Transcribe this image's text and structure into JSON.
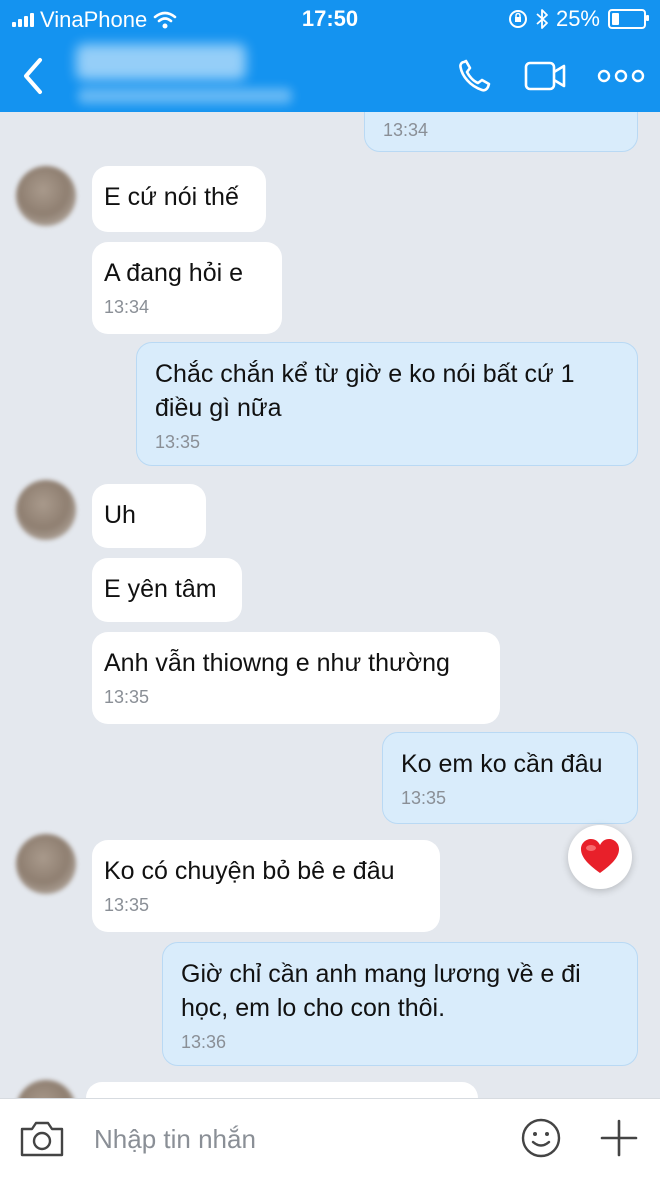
{
  "status_bar": {
    "carrier": "VinaPhone",
    "time": "17:50",
    "battery": "25%",
    "battery_level": 0.25,
    "icons": [
      "signal-icon",
      "wifi-icon",
      "orientation-lock-icon",
      "bluetooth-icon",
      "battery-icon"
    ]
  },
  "header": {
    "icons": [
      "back-icon",
      "phone-icon",
      "video-camera-icon",
      "more-icon"
    ],
    "background": "#1493f0"
  },
  "colors": {
    "outgoing_bubble": "#d9ecfb",
    "incoming_bubble": "#ffffff",
    "chat_background": "#e4e8ee",
    "reaction": "#e8202a"
  },
  "messages": [
    {
      "side": "out",
      "time": "13:34"
    },
    {
      "side": "in",
      "text": "E cứ nói thế"
    },
    {
      "side": "in",
      "text": "A đang hỏi e",
      "time": "13:34"
    },
    {
      "side": "out",
      "text": "Chắc chắn kể từ giờ e ko nói bất cứ 1\nđiều gì nữa",
      "time": "13:35"
    },
    {
      "side": "in",
      "text": "Uh"
    },
    {
      "side": "in",
      "text": "E yên tâm"
    },
    {
      "side": "in",
      "text": "Anh vẫn thiowng e như thường",
      "time": "13:35"
    },
    {
      "side": "out",
      "text": "Ko em ko cần đâu",
      "time": "13:35",
      "reaction": "heart-icon"
    },
    {
      "side": "in",
      "text": "Ko có chuyện bỏ bê e đâu",
      "time": "13:35"
    },
    {
      "side": "out",
      "text": "Giờ chỉ cần anh mang lương về e đi\nhọc, em lo cho con thôi.",
      "time": "13:36"
    }
  ],
  "composer": {
    "placeholder": "Nhập tin nhắn",
    "icons": [
      "camera-icon",
      "emoji-icon",
      "plus-icon"
    ]
  }
}
